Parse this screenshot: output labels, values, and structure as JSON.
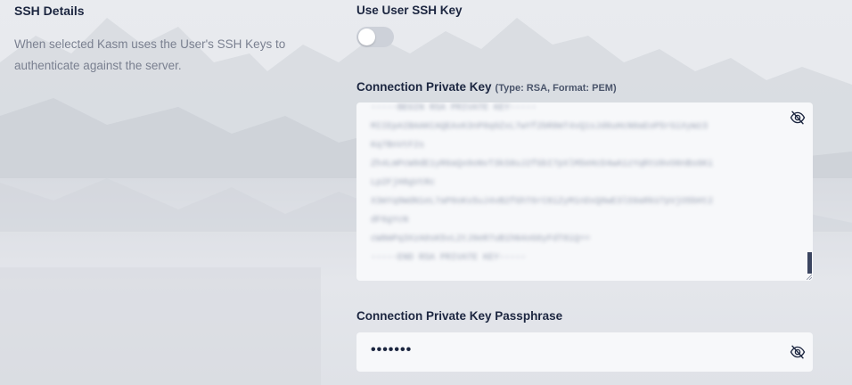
{
  "section": {
    "title": "SSH Details",
    "description": "When selected Kasm uses the User's SSH Keys to authenticate against the server."
  },
  "use_user_ssh_key": {
    "label": "Use User SSH Key",
    "enabled": false
  },
  "private_key": {
    "label": "Connection Private Key",
    "hint": "(Type: RSA, Format: PEM)",
    "visibility_icon": "eye-slash-icon"
  },
  "passphrase": {
    "label": "Connection Private Key Passphrase",
    "value": "•••••••",
    "visibility_icon": "eye-slash-icon"
  },
  "colors": {
    "label_text": "#1c2640",
    "muted_text": "#7a8090",
    "field_background": "#f7f8fa",
    "toggle_off": "#cdd1d9"
  }
}
